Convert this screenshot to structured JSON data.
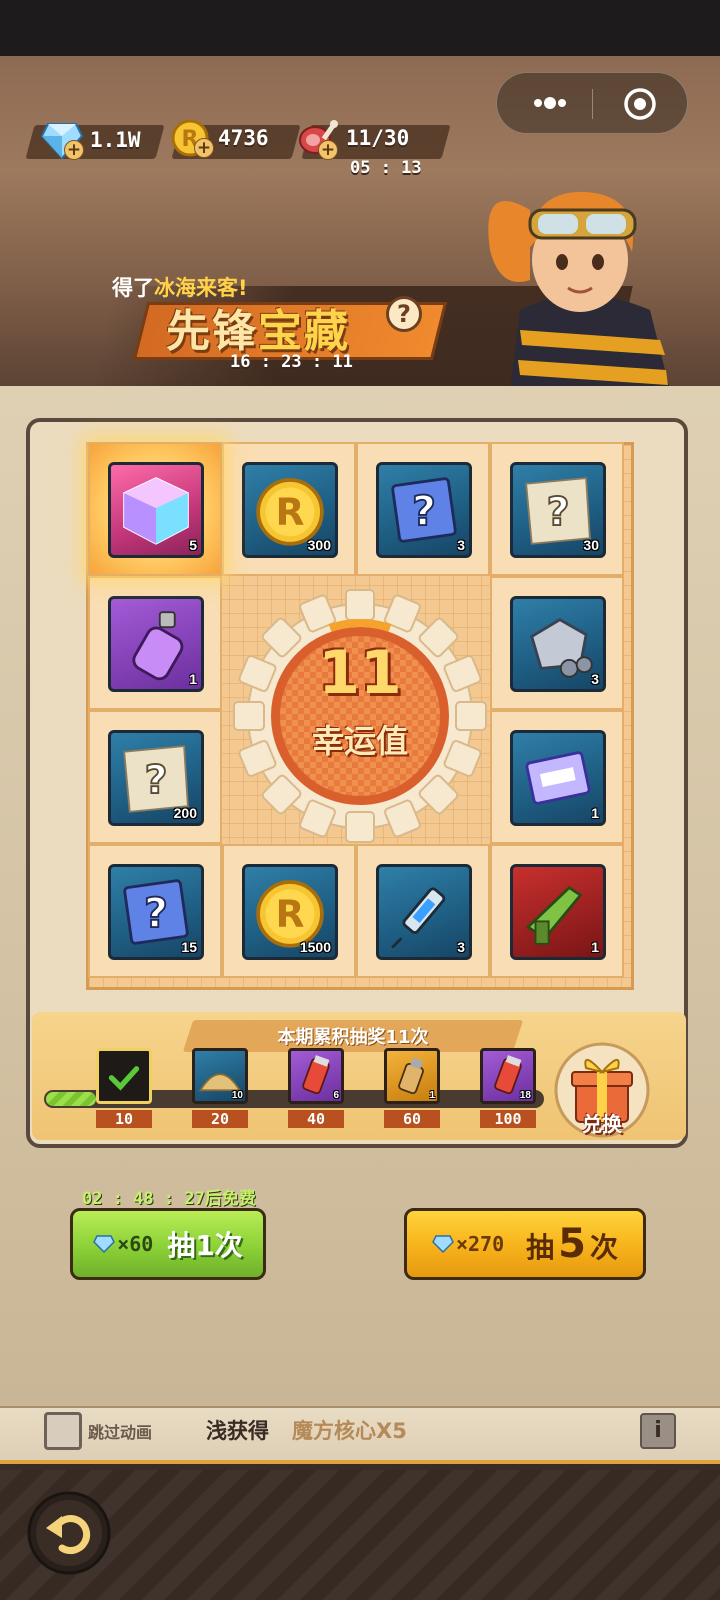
{
  "resources": {
    "gems": "1.1W",
    "coins": "4736",
    "stamina": "11/30",
    "stamina_timer": "05 : 13"
  },
  "top_capsule": {
    "more_icon": "more-icon",
    "close_icon": "target-icon"
  },
  "banner": {
    "ticker_prefix": "得了",
    "ticker_highlight": "冰海来客!",
    "title_part1": "先锋",
    "title_part2": "宝藏",
    "help_symbol": "?",
    "countdown": "16 : 23 : 11"
  },
  "board": {
    "luck_value": "11",
    "luck_label": "幸运值",
    "cells": [
      {
        "icon": "magic-cube-icon",
        "count": "5",
        "frame": "pink",
        "selected": true
      },
      {
        "icon": "gold-coin-icon",
        "count": "300",
        "frame": "blue"
      },
      {
        "icon": "mystery-box-icon",
        "count": "3",
        "frame": "blue"
      },
      {
        "icon": "mystery-blueprint-icon",
        "count": "30",
        "frame": "blue"
      },
      {
        "icon": "spray-can-icon",
        "count": "1",
        "frame": "purple"
      },
      {
        "icon": "metal-ore-icon",
        "count": "3",
        "frame": "blue"
      },
      {
        "icon": "mystery-blueprint-icon",
        "count": "200",
        "frame": "blue"
      },
      {
        "icon": "chip-card-icon",
        "count": "1",
        "frame": "blue"
      },
      {
        "icon": "mystery-box-icon",
        "count": "15",
        "frame": "blue"
      },
      {
        "icon": "gold-coin-icon",
        "count": "1500",
        "frame": "blue"
      },
      {
        "icon": "syringe-icon",
        "count": "3",
        "frame": "blue"
      },
      {
        "icon": "green-rifle-icon",
        "count": "1",
        "frame": "red"
      }
    ]
  },
  "progress": {
    "title": "本期累积抽奖11次",
    "fill_fraction": 0.03,
    "milestones": [
      {
        "threshold": "10",
        "icon": "check-icon",
        "count": "",
        "claimed": true
      },
      {
        "threshold": "20",
        "icon": "sand-pile-icon",
        "count": "10"
      },
      {
        "threshold": "40",
        "icon": "fuel-canister-icon",
        "count": "6"
      },
      {
        "threshold": "60",
        "icon": "bottle-icon",
        "count": "1"
      },
      {
        "threshold": "100",
        "icon": "fuel-canister-icon",
        "count": "18"
      }
    ],
    "exchange_label": "兑换"
  },
  "free_timer": {
    "time": "02 : 48 : 27",
    "suffix": "后免费"
  },
  "buttons": {
    "single": {
      "cost": "×60",
      "label": "抽1次"
    },
    "multi": {
      "cost": "×270",
      "label_prefix": "抽",
      "label_num": "5",
      "label_suffix": "次"
    }
  },
  "info_bar": {
    "skip_label": "跳过动画",
    "obtained_prefix": "浅获得",
    "obtained_item": "魔方核心X5",
    "info_symbol": "i"
  },
  "colors": {
    "accent_orange": "#e0a23e",
    "luck_gold": "#ffd86b",
    "free_timer_green": "#c8f06a"
  }
}
